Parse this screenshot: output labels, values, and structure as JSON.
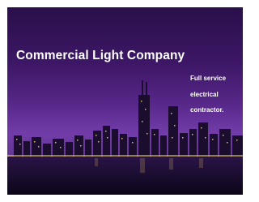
{
  "slide": {
    "title": "Commercial Light Company",
    "tagline": [
      "Full service",
      "electrical",
      "contractor."
    ]
  },
  "colors": {
    "sky_top": "#2a0f4a",
    "sky_glow": "#6a36a0",
    "water": "#150a26",
    "text": "#ffffff"
  }
}
